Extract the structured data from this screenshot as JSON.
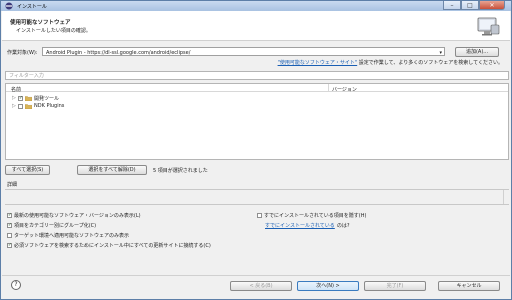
{
  "window": {
    "title": "インストール",
    "controls": {
      "minimize": "–",
      "maximize": "□",
      "close": "✕"
    }
  },
  "header": {
    "title": "使用可能なソフトウェア",
    "subtitle": "インストールしたい項目の確認。"
  },
  "work_with": {
    "label": "作業対象(W):",
    "value": "Android Plugin - https://dl-ssl.google.com/android/eclipse/",
    "add_button": "追加(A)..."
  },
  "hint": {
    "link": "\"使用可能なソフトウェア・サイト\"",
    "text": "設定で作業して、より多くのソフトウェアを検索してください。"
  },
  "filter": {
    "placeholder": "フィルター入力"
  },
  "tree": {
    "columns": {
      "name": "名前",
      "version": "バージョン"
    },
    "rows": [
      {
        "label": "開発ツール",
        "checked": true,
        "check_glyph": "✓"
      },
      {
        "label": "NDK Plugins",
        "checked": false,
        "check_glyph": ""
      }
    ]
  },
  "selection": {
    "select_all": "すべて選択(S)",
    "deselect_all": "選択をすべて解除(D)",
    "status": "5 項目が選択されました"
  },
  "details": {
    "label": "詳細"
  },
  "options": {
    "latest_only": "最新の使用可能なソフトウェア・バージョンのみ表示(L)",
    "group_by_category": "項目をカテゴリー別にグループ化(C)",
    "target_env_only": "ターゲット環境へ適用可能なソフトウェアのみ表示",
    "contact_all_sites": "必須ソフトウェアを検索するためにインストール中にすべての更新サイトに接続する(C)",
    "hide_installed": "すでにインストールされている項目を隠す(H)",
    "already_installed_link": "すでにインストールされている",
    "already_installed_suffix": "のは?"
  },
  "footer": {
    "help": "?",
    "back": "< 戻る(B)",
    "next": "次へ(N) >",
    "finish": "完了(F)",
    "cancel": "キャンセル"
  },
  "colors": {
    "link": "#1a5fb4",
    "titlebar": "#a9c2e2"
  }
}
